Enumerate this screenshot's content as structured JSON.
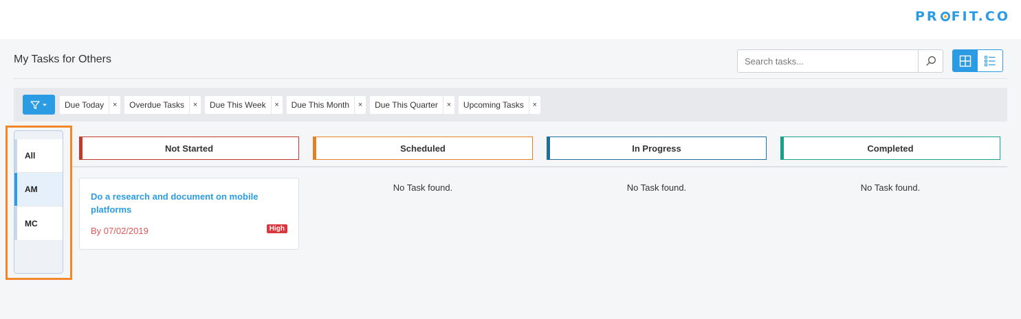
{
  "brand": {
    "logo_prefix": "PR",
    "logo_suffix": "FIT.CO",
    "accent_color": "#2b9be3"
  },
  "header": {
    "title": "My Tasks for Others"
  },
  "search": {
    "placeholder": "Search tasks...",
    "value": ""
  },
  "view_toggle": {
    "active": "grid-view"
  },
  "filters": {
    "chips": [
      {
        "label": "Due Today"
      },
      {
        "label": "Overdue Tasks"
      },
      {
        "label": "Due This Week"
      },
      {
        "label": "Due This Month"
      },
      {
        "label": "Due This Quarter"
      },
      {
        "label": "Upcoming Tasks"
      }
    ],
    "remove_symbol": "×"
  },
  "sidebar": {
    "items": [
      {
        "label": "All",
        "active": false
      },
      {
        "label": "AM",
        "active": true
      },
      {
        "label": "MC",
        "active": false
      }
    ]
  },
  "columns": [
    {
      "title": "Not Started",
      "color": "#c0392b"
    },
    {
      "title": "Scheduled",
      "color": "#e67e22"
    },
    {
      "title": "In Progress",
      "color": "#1f6f9e"
    },
    {
      "title": "Completed",
      "color": "#16a085"
    }
  ],
  "tasks": [
    {
      "title": "Do a research and document on mobile platforms",
      "due": "By 07/02/2019",
      "priority": "High",
      "column": "Not Started"
    }
  ],
  "empty_state": {
    "message": "No Task found."
  }
}
